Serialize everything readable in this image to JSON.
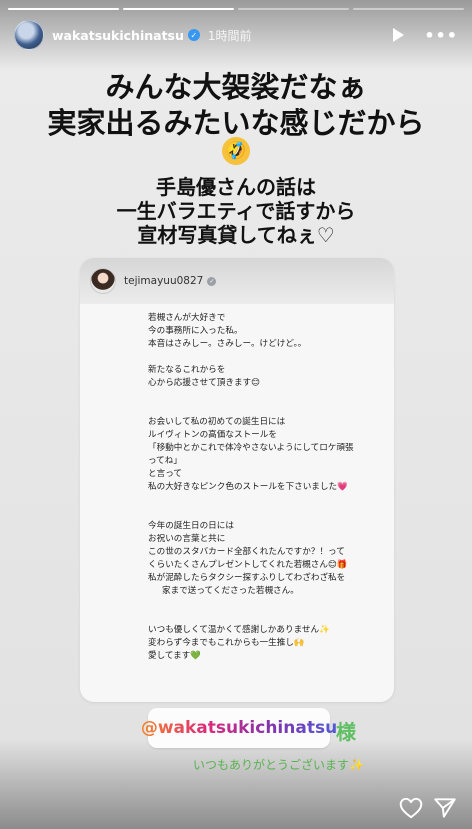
{
  "story": {
    "progress": {
      "total": 4,
      "completed": 2
    },
    "header": {
      "username": "wakatsukichinatsu",
      "verified_glyph": "✓",
      "time": "1時間前",
      "play_icon": "play-icon",
      "more_icon": "more-icon",
      "more_glyph": "•••"
    },
    "overlay_text": {
      "line1": "みんな大袈裟だなぁ",
      "line2": "実家出るみたいな感じだから",
      "emoji": "🤣",
      "line3": "手島優さんの話は",
      "line4": "一生バラエティで話すから",
      "line5": "宣材写真貸してねぇ♡"
    },
    "shared_post": {
      "username": "tejimayuu0827",
      "check_glyph": "✓",
      "lines": [
        "若槻さんが大好きで",
        "今の事務所に入った私。",
        "本音はさみしー。さみしー。けどけど。。",
        "",
        "新たなるこれからを",
        "心から応援させて頂きます😊",
        "",
        "",
        "お会いして私の初めての誕生日には",
        "ルイヴィトンの高価なストールを",
        "「移動中とかこれで体冷やさないようにしてロケ頑張",
        "ってね」",
        "と言って",
        "私の大好きなピンク色のストールを下さいました💗",
        "",
        "",
        "今年の誕生日の日には",
        "お祝いの言葉と共に",
        "この世のスタバカード全部くれたんですか？！って",
        "くらいたくさんプレゼントしてくれた若槻さん😊🎁",
        "私が泥酔したらタクシー探すふりしてわざわざ私を",
        "家まで送ってくださった若槻さん。",
        "",
        "",
        "いつも優しくて温かくて感謝しかありません✨",
        "変わらず今までもこれからも一生推し🙌",
        "愛してます💚"
      ]
    },
    "mention": {
      "text": "@wakatsukichinatsu",
      "suffix": "様"
    },
    "thanks": "いつもありがとうございます✨",
    "footer": {
      "like_icon": "heart-icon",
      "share_icon": "send-icon"
    }
  }
}
